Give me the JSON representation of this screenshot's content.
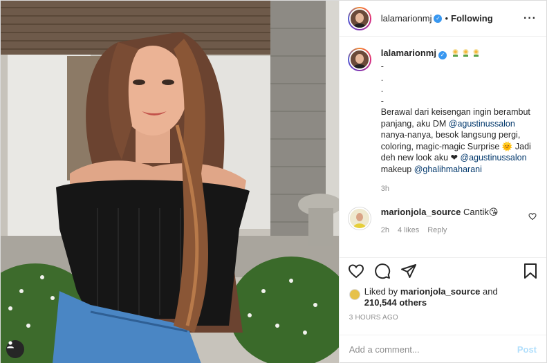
{
  "post": {
    "author": "lalamarionmj",
    "follow_dot": "•",
    "follow_status": "Following",
    "more_glyph": "···"
  },
  "caption": {
    "username": "lalamarionmj",
    "text": "-\n.\n.\n-\nBerawal dari keisengan ingin berambut panjang, aku DM ",
    "mention1": "@agustinussalon",
    "text2": " nanya-nanya, besok langsung pergi, coloring, magic-magic Surprise 🌞 Jadi deh new look aku ❤ ",
    "mention2": "@agustinussalon",
    "text3": " makeup ",
    "mention3": "@ghalihmaharani",
    "time": "3h"
  },
  "comment": {
    "username": "marionjola_source",
    "text": "Cantik😘",
    "time": "2h",
    "likes": "4 likes",
    "reply": "Reply"
  },
  "likes": {
    "prefix": "Liked by",
    "user": "marionjola_source",
    "middle": "and",
    "count": "210,544 others"
  },
  "posted_ago": "3 HOURS AGO",
  "composer": {
    "placeholder": "Add a comment...",
    "post_label": "Post"
  },
  "colors": {
    "link": "#00376b",
    "verified": "#3897f0",
    "post_button_disabled": "#b2dffc",
    "muted": "#8e8e8e"
  }
}
